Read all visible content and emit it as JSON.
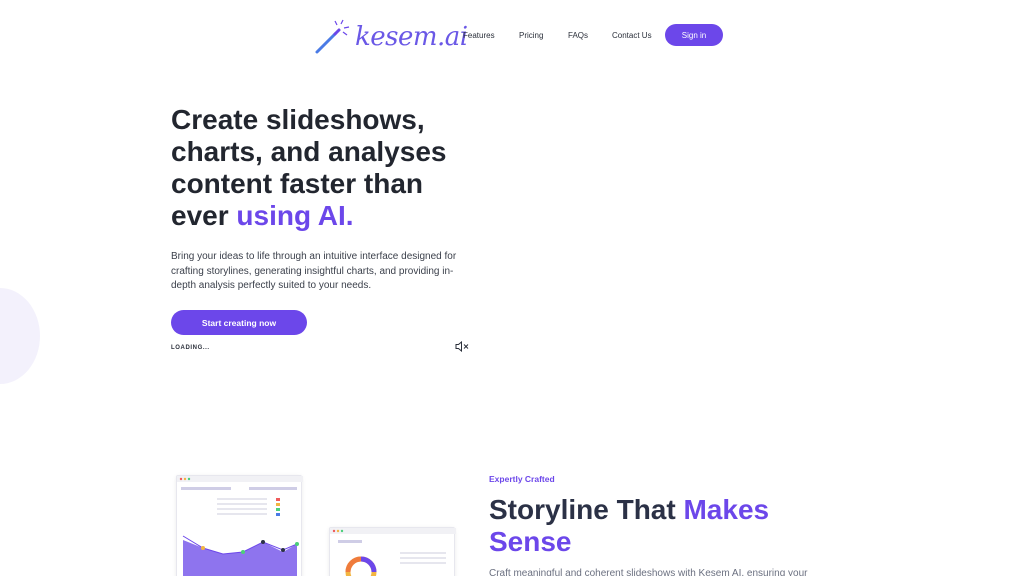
{
  "brand": {
    "name": "kesem.ai",
    "accent_color": "#6c47ea",
    "logo_icon": "magic-wand-icon"
  },
  "nav": {
    "items": [
      {
        "label": "Features"
      },
      {
        "label": "Pricing"
      },
      {
        "label": "FAQs"
      },
      {
        "label": "Contact Us"
      }
    ],
    "signin_label": "Sign in"
  },
  "hero": {
    "title_main": "Create slideshows, charts, and analyses content faster than ever ",
    "title_accent": "using AI.",
    "description": "Bring your ideas to life through an intuitive interface designed for crafting storylines, generating insightful charts, and providing in-depth analysis perfectly suited to your needs.",
    "cta_label": "Start creating now",
    "loading_label": "LOADING...",
    "mute_icon": "speaker-muted-icon"
  },
  "storyline": {
    "eyebrow": "Expertly Crafted",
    "title_main": "Storyline That ",
    "title_accent": "Makes Sense",
    "description": "Craft meaningful and coherent slideshows with Kesem AI, ensuring your"
  }
}
